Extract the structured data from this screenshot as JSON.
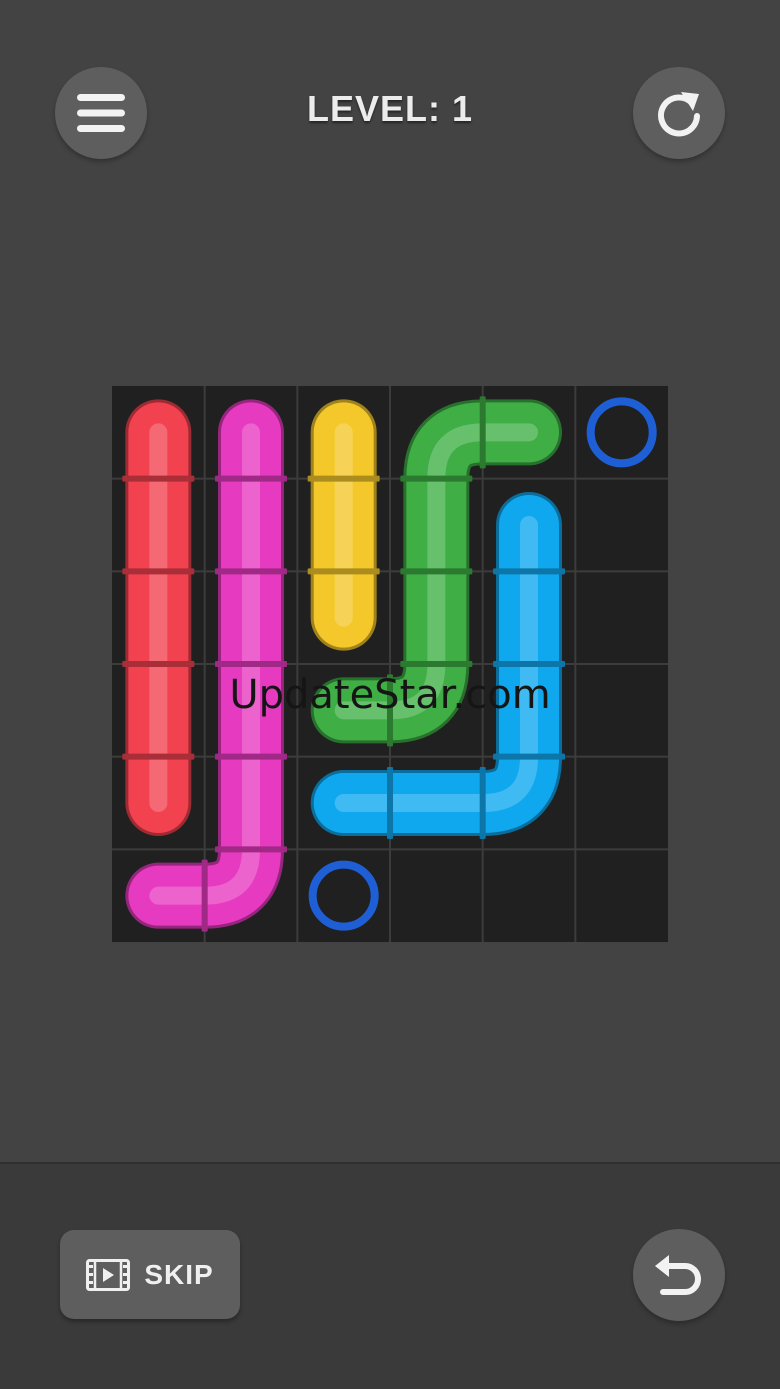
{
  "header": {
    "level_text": "LEVEL: 1"
  },
  "icons": {
    "menu": "hamburger-menu-icon",
    "restart": "restart-icon",
    "undo": "undo-icon",
    "skip": "video-film-icon"
  },
  "board": {
    "rows": 6,
    "cols": 6,
    "pipes": [
      {
        "color": "red",
        "hex": "#f2424f",
        "path": [
          [
            0,
            0
          ],
          [
            1,
            0
          ],
          [
            2,
            0
          ],
          [
            3,
            0
          ],
          [
            4,
            0
          ]
        ]
      },
      {
        "color": "magenta",
        "hex": "#e63ac0",
        "path": [
          [
            0,
            1
          ],
          [
            1,
            1
          ],
          [
            2,
            1
          ],
          [
            3,
            1
          ],
          [
            4,
            1
          ],
          [
            5,
            1
          ],
          [
            5,
            0
          ]
        ]
      },
      {
        "color": "yellow",
        "hex": "#f4c82a",
        "path": [
          [
            0,
            2
          ],
          [
            1,
            2
          ],
          [
            2,
            2
          ]
        ]
      },
      {
        "color": "green",
        "hex": "#3eae45",
        "path": [
          [
            0,
            4
          ],
          [
            0,
            3
          ],
          [
            1,
            3
          ],
          [
            2,
            3
          ],
          [
            3,
            3
          ],
          [
            3,
            2
          ]
        ]
      },
      {
        "color": "cyan",
        "hex": "#0fa8ef",
        "path": [
          [
            1,
            4
          ],
          [
            2,
            4
          ],
          [
            3,
            4
          ],
          [
            4,
            4
          ],
          [
            4,
            3
          ],
          [
            4,
            2
          ]
        ]
      }
    ],
    "endpoints": [
      {
        "color": "blue",
        "hex": "#1f5fd6",
        "cell": [
          0,
          5
        ]
      },
      {
        "color": "blue",
        "hex": "#1f5fd6",
        "cell": [
          5,
          2
        ]
      }
    ]
  },
  "footer": {
    "skip_label": "SKIP"
  },
  "watermark": "UpdateStar.com"
}
